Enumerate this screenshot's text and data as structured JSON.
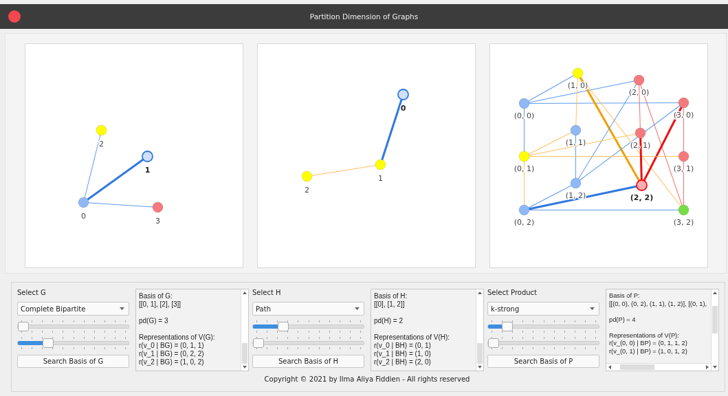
{
  "window": {
    "title": "Partition Dimension of Graphs"
  },
  "graphs": [
    {
      "nodes": [
        {
          "label": "0",
          "color": "#8fb8f5",
          "selected": false
        },
        {
          "label": "1",
          "color": "#cfe0f8",
          "selected": true
        },
        {
          "label": "2",
          "color": "#ffff00",
          "selected": false
        },
        {
          "label": "3",
          "color": "#f47a7e",
          "selected": false
        }
      ]
    },
    {
      "nodes": [
        {
          "label": "0",
          "color": "#cfe0f8",
          "selected": true
        },
        {
          "label": "1",
          "color": "#ffff00",
          "selected": false
        },
        {
          "label": "2",
          "color": "#ffff00",
          "selected": false
        }
      ]
    },
    {
      "nodes": [
        {
          "label": "(0, 0)",
          "color": "#8fb8f5",
          "selected": false
        },
        {
          "label": "(1, 0)",
          "color": "#ffff00",
          "selected": false
        },
        {
          "label": "(2, 0)",
          "color": "#f47a7e",
          "selected": false
        },
        {
          "label": "(3, 0)",
          "color": "#f47a7e",
          "selected": false
        },
        {
          "label": "(1, 1)",
          "color": "#8fb8f5",
          "selected": false
        },
        {
          "label": "(2, 1)",
          "color": "#f47a7e",
          "selected": false
        },
        {
          "label": "(0, 1)",
          "color": "#ffff00",
          "selected": false
        },
        {
          "label": "(3, 1)",
          "color": "#f47a7e",
          "selected": false
        },
        {
          "label": "(1, 2)",
          "color": "#8fb8f5",
          "selected": false
        },
        {
          "label": "(2, 2)",
          "color": "#f9aeb3",
          "selected": true
        },
        {
          "label": "(0, 2)",
          "color": "#8fb8f5",
          "selected": false
        },
        {
          "label": "(3, 2)",
          "color": "#77dd44",
          "selected": false
        }
      ]
    }
  ],
  "controls": [
    {
      "label": "Select G",
      "dropdown": "Complete Bipartite",
      "sliders": [
        {
          "level": 0.0
        },
        {
          "level": 0.25
        }
      ],
      "button": "Search Basis of G",
      "output": [
        [
          "Basis of G:",
          "[[0, 1], [2], [3]]"
        ],
        [
          "pd(G) = 3"
        ],
        [
          "Representations of V(G):",
          "r(v_0 | BG) = (0, 1, 1)",
          "r(v_1 | BG) = (0, 2, 2)",
          "r(v_2 | BG) = (1, 0, 2)"
        ]
      ],
      "hscroll": false
    },
    {
      "label": "Select H",
      "dropdown": "Path",
      "sliders": [
        {
          "level": 0.25
        },
        {
          "level": 0.0
        }
      ],
      "button": "Search Basis of H",
      "output": [
        [
          "Basis of H:",
          "[[0], [1, 2]]"
        ],
        [
          "pd(H) = 2"
        ],
        [
          "Representations of V(H):",
          "r(v_0 | BH) = (0, 1)",
          "r(v_1 | BH) = (1, 0)",
          "r(v_2 | BH) = (2, 0)"
        ]
      ],
      "hscroll": false
    },
    {
      "label": "Select Product",
      "dropdown": "k-strong",
      "sliders": [
        {
          "level": 0.14
        },
        {
          "level": 0.0
        }
      ],
      "button": "Search Basis of P",
      "output": [
        [
          "Basis of P:",
          "[[(0, 0), (0, 2), (1, 1), (1, 2)], [(0, 1),"
        ],
        [
          "pd(P) = 4"
        ],
        [
          "Representations of V(P):",
          "r(v_(0, 0) | BP) = (0, 1, 1, 2)",
          "r(v_(0, 1) | BP) = (1, 0, 1, 2)"
        ]
      ],
      "hscroll": true
    }
  ],
  "footer": "Copyright © 2021 by Ilma Aliya Fiddien - All rights reserved"
}
